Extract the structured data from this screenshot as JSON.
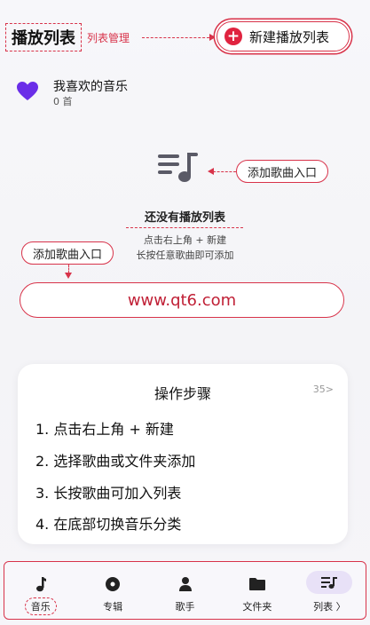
{
  "header": {
    "title": "播放列表",
    "annotation": "列表管理",
    "new_button_label": "新建播放列表"
  },
  "favorites": {
    "title": "我喜欢的音乐",
    "count": "0 首",
    "icon": "heart-icon",
    "color": "#6a2ee8"
  },
  "empty_state": {
    "icon": "playlist-add-icon",
    "annotation": "添加歌曲入口",
    "title": "还没有播放列表",
    "line1": "点击右上角 + 新建",
    "line2": "长按任意歌曲即可添加",
    "left_annotation": "添加歌曲入口"
  },
  "watermark": {
    "url": "www.qt6.com"
  },
  "steps": {
    "title": "操作步骤",
    "badge": "35>",
    "items": [
      "1. 点击右上角 + 新建",
      "2. 选择歌曲或文件夹添加",
      "3. 长按歌曲可加入列表",
      "4. 在底部切换音乐分类"
    ]
  },
  "nav": {
    "items": [
      {
        "label": "音乐",
        "icon": "music-note-icon"
      },
      {
        "label": "专辑",
        "icon": "album-disc-icon"
      },
      {
        "label": "歌手",
        "icon": "person-icon"
      },
      {
        "label": "文件夹",
        "icon": "folder-icon"
      },
      {
        "label": "列表 〉",
        "icon": "playlist-icon"
      }
    ]
  },
  "colors": {
    "accent": "#d8334a",
    "active_tab": "#e8e1f7",
    "heart": "#6a2ee8"
  }
}
